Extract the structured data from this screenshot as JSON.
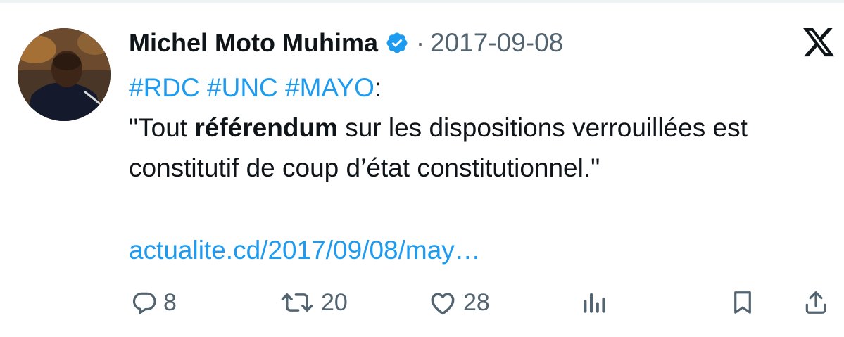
{
  "tweet": {
    "author_name": "Michel Moto Muhima",
    "verified": true,
    "separator": "·",
    "date": "2017-09-08",
    "hashtags": [
      "#RDC",
      "#UNC",
      "#MAYO"
    ],
    "hashtag_suffix": ":",
    "quote_open": "\"Tout ",
    "quote_bold": "référendum",
    "quote_rest": " sur les dispositions verrouillées est constitutif de coup d’état constitutionnel.\"",
    "link_text": "actualite.cd/2017/09/08/may…"
  },
  "actions": {
    "replies": "8",
    "retweets": "20",
    "likes": "28"
  },
  "colors": {
    "link": "#1d9bf0",
    "muted": "#536471",
    "text": "#0f1419"
  },
  "icons": {
    "platform": "x-logo-icon",
    "verified": "verified-badge-icon",
    "reply": "reply-icon",
    "retweet": "retweet-icon",
    "like": "heart-icon",
    "views": "analytics-icon",
    "bookmark": "bookmark-icon",
    "share": "share-icon"
  }
}
